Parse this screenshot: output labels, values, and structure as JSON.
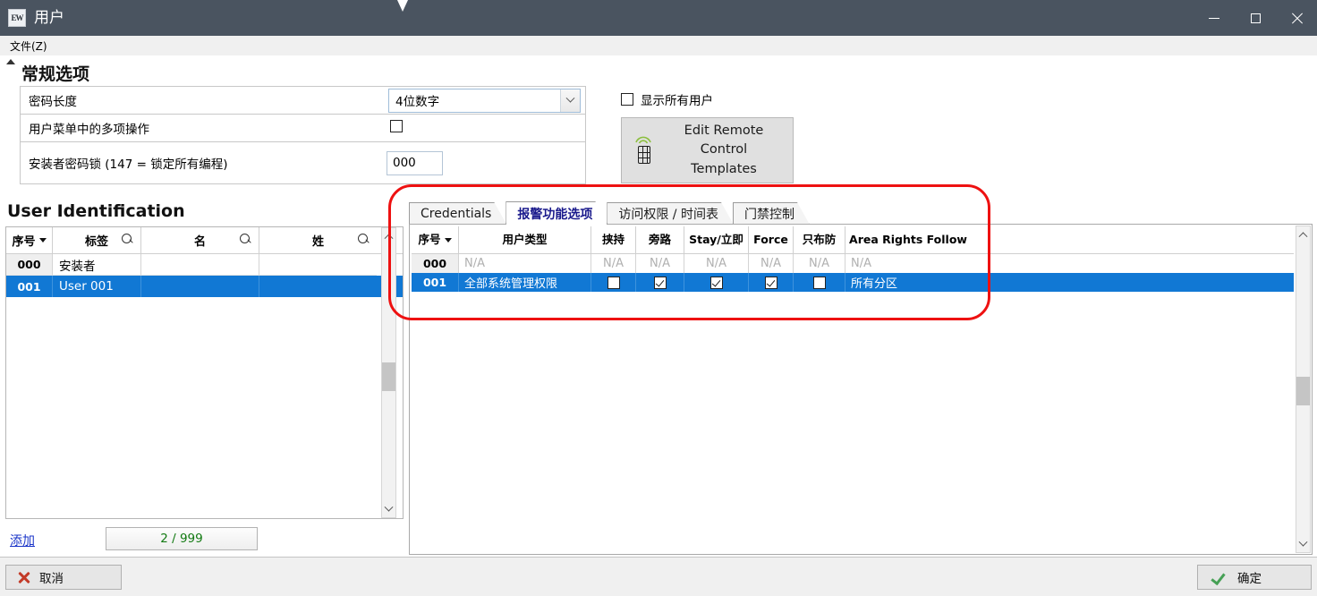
{
  "window": {
    "title": "用户",
    "icon": "app-icon",
    "controls": {
      "minimize": "minimize-icon",
      "maximize": "maximize-icon",
      "close": "close-icon"
    }
  },
  "menubar": {
    "file": "文件(Z)"
  },
  "general_options": {
    "heading": "常规选项",
    "rows": [
      {
        "label": "密码长度",
        "control": "combo",
        "value": "4位数字"
      },
      {
        "label": "用户菜单中的多项操作",
        "control": "checkbox",
        "checked": false
      },
      {
        "label": "安装者密码锁 (147 = 锁定所有编程)",
        "control": "text",
        "value": "000"
      }
    ]
  },
  "show_all_users": {
    "label": "显示所有用户",
    "checked": false
  },
  "remote_templates_button": {
    "line1": "Edit Remote Control",
    "line2": "Templates",
    "icon": "remote-control-icon"
  },
  "user_identification": {
    "heading": "User Identification",
    "columns": [
      {
        "label": "序号",
        "sorted": true,
        "search": false
      },
      {
        "label": "标签",
        "sorted": false,
        "search": true
      },
      {
        "label": "名",
        "sorted": false,
        "search": true
      },
      {
        "label": "姓",
        "sorted": false,
        "search": true
      }
    ],
    "rows": [
      {
        "index": "000",
        "tag": "安装者",
        "first": "",
        "last": "",
        "selected": false
      },
      {
        "index": "001",
        "tag": "User 001",
        "first": "",
        "last": "",
        "selected": true
      }
    ],
    "add_link": "添加",
    "counter": "2 / 999"
  },
  "tabs": [
    {
      "label": "Credentials",
      "active": false
    },
    {
      "label": "报警功能选项",
      "active": true
    },
    {
      "label": "访问权限 / 时间表",
      "active": false
    },
    {
      "label": "门禁控制",
      "active": false
    }
  ],
  "alarm_grid": {
    "columns": [
      "序号",
      "用户类型",
      "挟持",
      "旁路",
      "Stay/立即",
      "Force",
      "只布防",
      "Area Rights Follow"
    ],
    "rows": [
      {
        "index": "000",
        "user_type": "N/A",
        "duress": "N/A",
        "bypass": "N/A",
        "stay": "N/A",
        "force": "N/A",
        "arm_only": "N/A",
        "area_rights": "N/A",
        "selected": false,
        "na": true
      },
      {
        "index": "001",
        "user_type": "全部系统管理权限",
        "duress": false,
        "bypass": true,
        "stay": true,
        "force": true,
        "arm_only": false,
        "area_rights": "所有分区",
        "selected": true,
        "na": false
      }
    ]
  },
  "footer": {
    "cancel": "取消",
    "ok": "确定"
  },
  "colors": {
    "titlebar": "#4a5460",
    "selection": "#1178d4",
    "active_tab_text": "#1a1a8c",
    "link": "#1a34c8",
    "counter_text": "#127a12",
    "annotation": "#ee1111",
    "ok_check": "#46a055",
    "cancel_x": "#c33b28"
  }
}
